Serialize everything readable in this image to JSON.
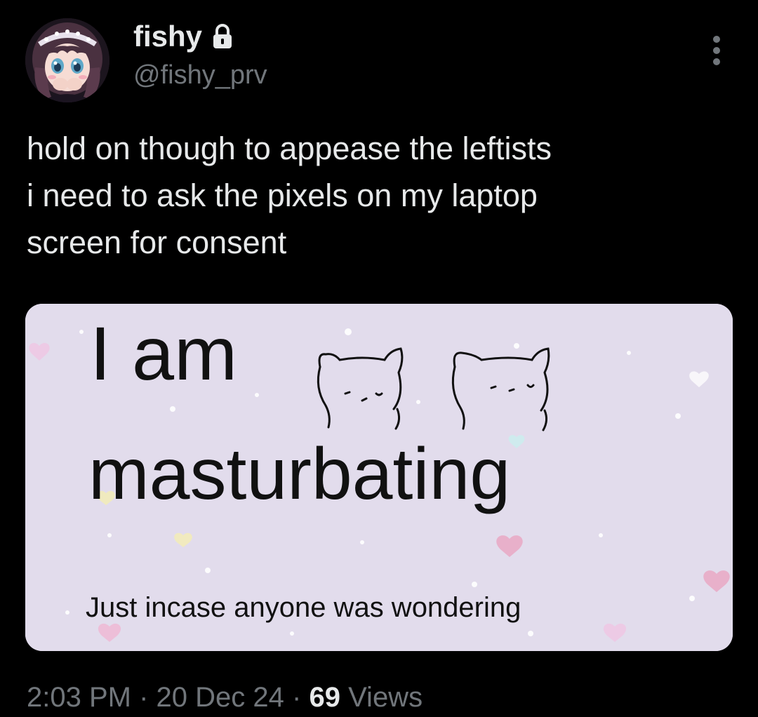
{
  "author": {
    "display_name": "fishy",
    "handle": "@fishy_prv",
    "protected_icon": "lock-icon",
    "avatar_icon": "anime-avatar"
  },
  "more_icon": "more-vertical-icon",
  "tweet": {
    "text": "hold on though to appease the leftists\ni need to ask the pixels on my laptop\nscreen for consent"
  },
  "media": {
    "line1": "I am",
    "line2": "masturbating",
    "caption": "Just incase anyone was wondering",
    "caption_highlight_color": "#b04fc4",
    "background_color": "#e2dcec"
  },
  "meta": {
    "time": "2:03 PM",
    "separator": "·",
    "date": "20 Dec 24",
    "views_count": "69",
    "views_label": "Views"
  },
  "colors": {
    "background": "#000000",
    "primary_text": "#e7e9ea",
    "secondary_text": "#71767b"
  }
}
